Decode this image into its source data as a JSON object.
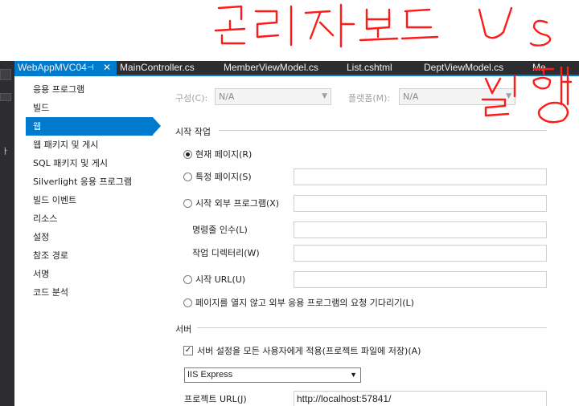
{
  "tabs": [
    {
      "label": "WebAppMVC04",
      "active": true
    },
    {
      "label": "MainController.cs"
    },
    {
      "label": "MemberViewModel.cs"
    },
    {
      "label": "List.cshtml"
    },
    {
      "label": "DeptViewModel.cs"
    },
    {
      "label": "Me"
    }
  ],
  "nav": {
    "items": [
      "응용 프로그램",
      "빌드",
      "웹",
      "웹 패키지 및 게시",
      "SQL 패키지 및 게시",
      "Silverlight 응용 프로그램",
      "빌드 이벤트",
      "리소스",
      "설정",
      "참조 경로",
      "서명",
      "코드 분석"
    ],
    "selected": "웹"
  },
  "config": {
    "config_label": "구성(C):",
    "config_value": "N/A",
    "platform_label": "플랫폼(M):",
    "platform_value": "N/A"
  },
  "start_action": {
    "header": "시작 작업",
    "current_page": "현재 페이지(R)",
    "specific_page": "특정 페이지(S)",
    "external_program": "시작 외부 프로그램(X)",
    "cmd_args": "명령줄 인수(L)",
    "working_dir": "작업 디렉터리(W)",
    "start_url": "시작 URL(U)",
    "dont_open": "페이지를 열지 않고 외부 응용 프로그램의 요청 기다리기(L)",
    "selected": "current_page"
  },
  "server": {
    "header": "서버",
    "apply_all_label": "서버 설정을 모든 사용자에게 적용(프로젝트 파일에 저장)(A)",
    "apply_all_checked": true,
    "server_type": "IIS Express",
    "project_url_label": "프로젝트 URL(J)",
    "project_url": "http://localhost:57841/"
  },
  "icons": {
    "pin": "pin-icon",
    "close": "close-icon",
    "dropdown": "chevron-down-icon"
  },
  "colors": {
    "accent": "#007acc",
    "ide_dark": "#2d2d30",
    "annotation": "#ff1a1a"
  }
}
